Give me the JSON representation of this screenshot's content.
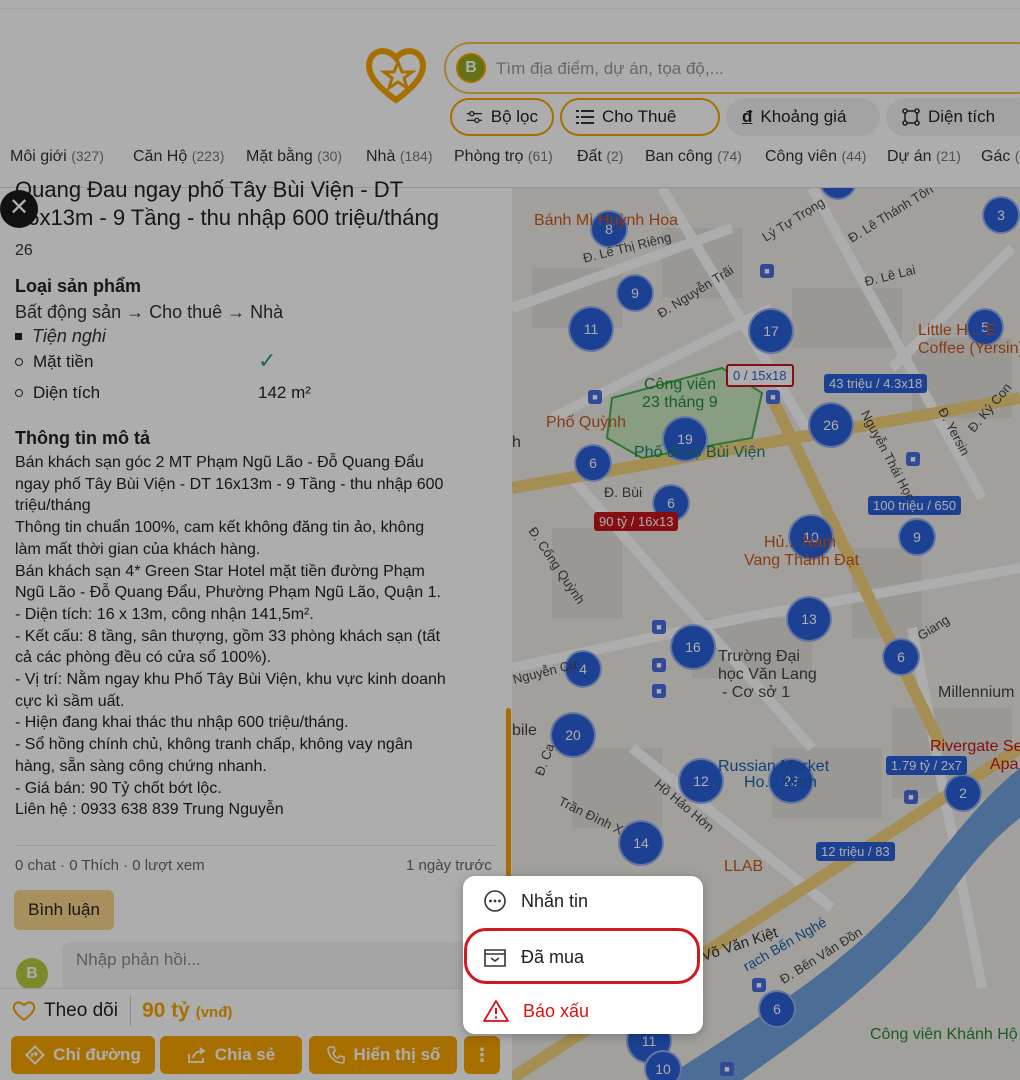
{
  "search": {
    "avatar_letter": "B",
    "placeholder": "Tìm địa điểm, dự án, tọa độ,..."
  },
  "filters": [
    {
      "label": "Bộ lọc",
      "icon": "sliders-icon"
    },
    {
      "label": "Cho Thuê",
      "icon": "list-icon"
    },
    {
      "label": "Khoảng giá",
      "icon": "dong-icon",
      "icon_glyph": "đ"
    },
    {
      "label": "Diện tích",
      "icon": "area-icon"
    }
  ],
  "categories": [
    {
      "name": "Môi giới",
      "count": "(327)"
    },
    {
      "name": "Căn Hộ",
      "count": "(223)"
    },
    {
      "name": "Mặt bằng",
      "count": "(30)"
    },
    {
      "name": "Nhà",
      "count": "(184)"
    },
    {
      "name": "Phòng trọ",
      "count": "(61)"
    },
    {
      "name": "Đất",
      "count": "(2)"
    },
    {
      "name": "Ban công",
      "count": "(74)"
    },
    {
      "name": "Công viên",
      "count": "(44)"
    },
    {
      "name": "Dự án",
      "count": "(21)"
    },
    {
      "name": "Gác",
      "count": "("
    }
  ],
  "listing": {
    "title_line1": "Quang Đau ngay phố Tây Bùi Viện - DT",
    "title_line2": "16x13m - 9 Tầng - thu nhập 600 triệu/tháng",
    "title_line3": "26",
    "product_type_heading": "Loại sản phẩm",
    "product_type_path": "Bất động sản → Cho thuê → Nhà",
    "amenities_heading": "Tiện nghi",
    "amenities": [
      {
        "label": "Mặt tiền",
        "value": "✓"
      },
      {
        "label": "Diện tích",
        "value": "142 m²"
      }
    ],
    "description_heading": "Thông tin mô tả",
    "description_lines": [
      "Bán khách sạn góc 2 MT Phạm Ngũ Lão - Đỗ Quang Đẩu",
      "ngay phố Tây Bùi Viện - DT 16x13m - 9 Tầng - thu nhập 600",
      "triệu/tháng",
      "Thông tin chuẩn 100%, cam kết không đăng tin ảo, không",
      "làm mất thời gian của khách hàng.",
      "Bán khách sạn 4* Green Star Hotel mặt tiền đường Phạm",
      "Ngũ Lão - Đỗ Quang Đẩu, Phường Phạm Ngũ Lão, Quận 1.",
      "- Diện tích: 16 x 13m, công nhận 141,5m².",
      "- Kết cấu: 8 tầng, sân thượng, gồm 33 phòng khách sạn (tất",
      "cả các phòng đều có cửa sổ 100%).",
      "- Vị trí: Nằm ngay khu Phố Tây Bùi Viện, khu vực kinh doanh",
      "cực kì sầm uất.",
      "- Hiện đang khai thác thu nhập 600 triệu/tháng.",
      "- Sổ hồng chính chủ, không tranh chấp, không vay ngân",
      "hàng, sẵn sàng công chứng nhanh.",
      "- Giá bán: 90 Tỷ chốt bớt lộc.",
      "Liên hệ : 0933 638 839 Trung Nguyễn"
    ],
    "stats": "0 chat · 0 Thích · 0 lượt xem",
    "posted": "1 ngày trước"
  },
  "comments": {
    "tab_label": "Bình luận",
    "avatar_letter": "B",
    "reply_placeholder": "Nhập phản hồi..."
  },
  "bottom": {
    "follow_label": "Theo dõi",
    "price": "90 tỷ",
    "price_unit": "(vnđ)",
    "buttons": [
      {
        "label": "Chỉ đường",
        "icon": "directions-icon"
      },
      {
        "label": "Chia sẻ",
        "icon": "share-icon"
      },
      {
        "label": "Hiển thị số",
        "icon": "phone-icon"
      }
    ],
    "more_icon": "more-vertical-icon"
  },
  "context_menu": [
    {
      "label": "Nhắn tin",
      "icon": "chat-bubble-icon"
    },
    {
      "label": "Đã mua",
      "icon": "purchased-box-icon"
    },
    {
      "label": "Báo xấu",
      "icon": "warning-icon"
    }
  ],
  "map": {
    "clusters": [
      "5",
      "3",
      "8",
      "9",
      "11",
      "17",
      "5",
      "26",
      "19",
      "6",
      "6",
      "10",
      "9",
      "13",
      "16",
      "6",
      "4",
      "20",
      "12",
      "23",
      "2",
      "14",
      "11",
      "6",
      "10"
    ],
    "price_labels": [
      {
        "text": "0 / 15x18",
        "kind": "blue-outline"
      },
      {
        "text": "43 triệu / 4.3x18",
        "kind": "blue"
      },
      {
        "text": "90 tỷ / 16x13",
        "kind": "red"
      },
      {
        "text": "100 triệu / 650",
        "kind": "blue"
      },
      {
        "text": "1.79 tỷ / 2x7",
        "kind": "blue"
      },
      {
        "text": "12 triệu / 83",
        "kind": "blue"
      }
    ],
    "place_labels": [
      "Bánh Mì Huỳnh Hoa",
      "Đ. Lê Thị Riêng",
      "Lý Tự Trọng",
      "Đ. Lê Thánh Tôn",
      "Đ. Lê Lai",
      "Đ. Nguyễn Trãi",
      "Little H... E",
      "Coffee (Yersin)",
      "Công viên",
      "23 tháng 9",
      "Phố Quỳnh",
      "Phố đi bộ Bùi Viện",
      "Nguyễn Thái Học",
      "Đ. Yersin",
      "Đ. Ký Con",
      "Đ. Bùi",
      "Đ. Cống Quỳnh",
      "Hủ... Nam",
      "Vang Thành Đạt",
      "Trường Đại",
      "học Văn Lang",
      "- Cơ sở 1",
      "Giang",
      "Millennium",
      "Rivergate Se",
      "Apa",
      "Russian Market",
      "Ho... Minh",
      "Hồ Hảo Hớn",
      "Trần Đình X",
      "LLAB",
      "Võ Văn Kiệt",
      "rạch Bến Nghé",
      "Đ. Bến Vân Đồn",
      "Công viên Khánh Hộ",
      "Nguyễn Cư",
      "bile",
      "Đ. Ca",
      "h"
    ]
  }
}
